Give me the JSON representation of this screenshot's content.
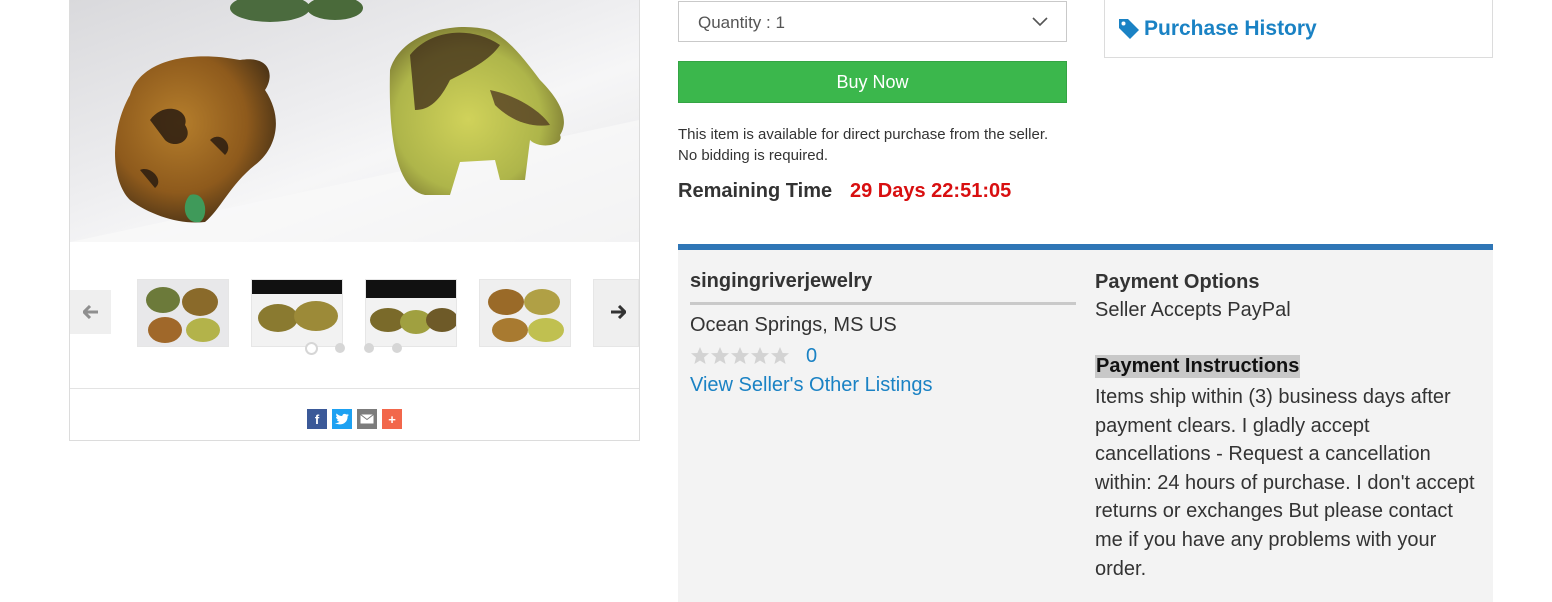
{
  "quantity": {
    "label": "Quantity : 1"
  },
  "buy_now": {
    "label": "Buy Now"
  },
  "availability": {
    "line1": "This item is available for direct purchase from the seller.",
    "line2": "No bidding is required."
  },
  "remaining_time": {
    "label": "Remaining Time",
    "value": "29 Days 22:51:05"
  },
  "purchase_history": {
    "label": "Purchase History",
    "icon": "tag-icon"
  },
  "seller": {
    "name": "singingriverjewelry",
    "location": "Ocean Springs, MS US",
    "rating_stars": 0,
    "rating_max": 5,
    "feedback_count": "0",
    "other_listings": "View Seller's Other Listings"
  },
  "payment": {
    "options_title": "Payment Options",
    "options_value": "Seller Accepts PayPal",
    "instructions_title": "Payment Instructions",
    "instructions_text": "Items ship within (3) business days after payment clears. I gladly accept cancellations - Request a cancellation within: 24 hours of purchase. I don't accept returns or exchanges But please contact me if you have any problems with your order."
  },
  "gallery": {
    "thumbnail_count": 5,
    "page_dots": 4,
    "active_dot": 0
  },
  "share": [
    "facebook-icon",
    "twitter-icon",
    "email-icon",
    "more-share-icon"
  ],
  "colors": {
    "buy_green": "#3bb74c",
    "link_blue": "#1a82c4",
    "timer_red": "#d80f10",
    "panel_border_blue": "#2f76b6"
  }
}
